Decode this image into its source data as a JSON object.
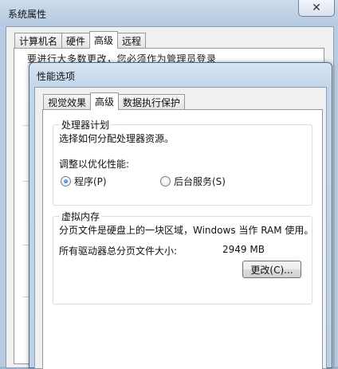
{
  "system_properties": {
    "title": "系统属性",
    "close_glyph": "✕",
    "tabs": [
      {
        "label": "计算机名",
        "active": false
      },
      {
        "label": "硬件",
        "active": false
      },
      {
        "label": "高级",
        "active": true
      },
      {
        "label": "远程",
        "active": false
      }
    ],
    "partial_text": "要进行大多数更改，您必须作为管理员登录"
  },
  "performance_options": {
    "title": "性能选项",
    "tabs": [
      {
        "label": "视觉效果",
        "active": false
      },
      {
        "label": "高级",
        "active": true
      },
      {
        "label": "数据执行保护",
        "active": false
      }
    ],
    "processor_scheduling": {
      "title": "处理器计划",
      "description": "选择如何分配处理器资源。",
      "adjust_label": "调整以优化性能:",
      "options": [
        {
          "label": "程序(P)",
          "checked": true
        },
        {
          "label": "后台服务(S)",
          "checked": false
        }
      ]
    },
    "virtual_memory": {
      "title": "虚拟内存",
      "description": "分页文件是硬盘上的一块区域，Windows 当作 RAM 使用。",
      "total_label": "所有驱动器总分页文件大小:",
      "total_value": "2949 MB",
      "change_button": "更改(C)..."
    }
  }
}
